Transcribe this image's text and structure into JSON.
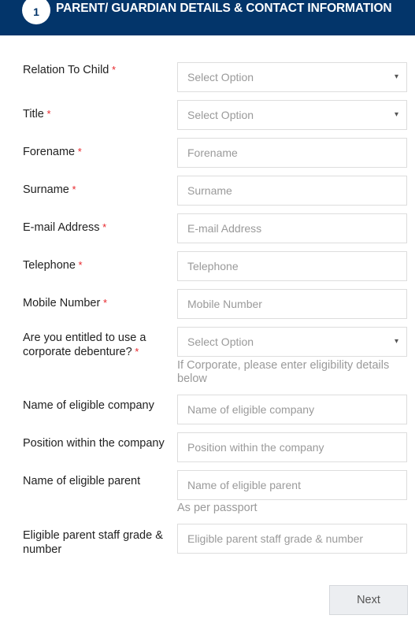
{
  "header": {
    "step_number": "1",
    "title": "PARENT/ GUARDIAN DETAILS & CONTACT INFORMATION",
    "background_color": "#03356a",
    "badge_color": "#ffffff"
  },
  "colors": {
    "required_asterisk": "#e8262b",
    "field_border": "#dddddd",
    "placeholder": "#9a9a9a",
    "label": "#222222",
    "button_background": "#eceef1"
  },
  "form": {
    "fields": [
      {
        "label": "Relation To Child",
        "required": true,
        "type": "select",
        "value": "Select Option",
        "caret": "▾"
      },
      {
        "label": "Title",
        "required": true,
        "type": "select",
        "value": "Select Option",
        "caret": "▾"
      },
      {
        "label": "Forename",
        "required": true,
        "type": "text",
        "placeholder": "Forename"
      },
      {
        "label": "Surname",
        "required": true,
        "type": "text",
        "placeholder": "Surname"
      },
      {
        "label": "E-mail Address",
        "required": true,
        "type": "text",
        "placeholder": "E-mail Address"
      },
      {
        "label": "Telephone",
        "required": true,
        "type": "text",
        "placeholder": "Telephone"
      },
      {
        "label": "Mobile Number",
        "required": true,
        "type": "text",
        "placeholder": "Mobile Number"
      },
      {
        "label": "Are you entitled to use a corporate debenture?",
        "required": true,
        "type": "select",
        "value": "Select Option",
        "caret": "▾",
        "helper": "If Corporate, please enter eligibility details below"
      },
      {
        "label": "Name of eligible company",
        "required": false,
        "type": "text",
        "placeholder": "Name of eligible company"
      },
      {
        "label": "Position within the company",
        "required": false,
        "type": "text",
        "placeholder": "Position within the company"
      },
      {
        "label": "Name of eligible parent",
        "required": false,
        "type": "text",
        "placeholder": "Name of eligible parent",
        "helper": "As per passport"
      },
      {
        "label": "Eligible parent staff grade & number",
        "required": false,
        "type": "text",
        "placeholder": "Eligible parent staff grade & number"
      }
    ],
    "next_button": "Next"
  }
}
